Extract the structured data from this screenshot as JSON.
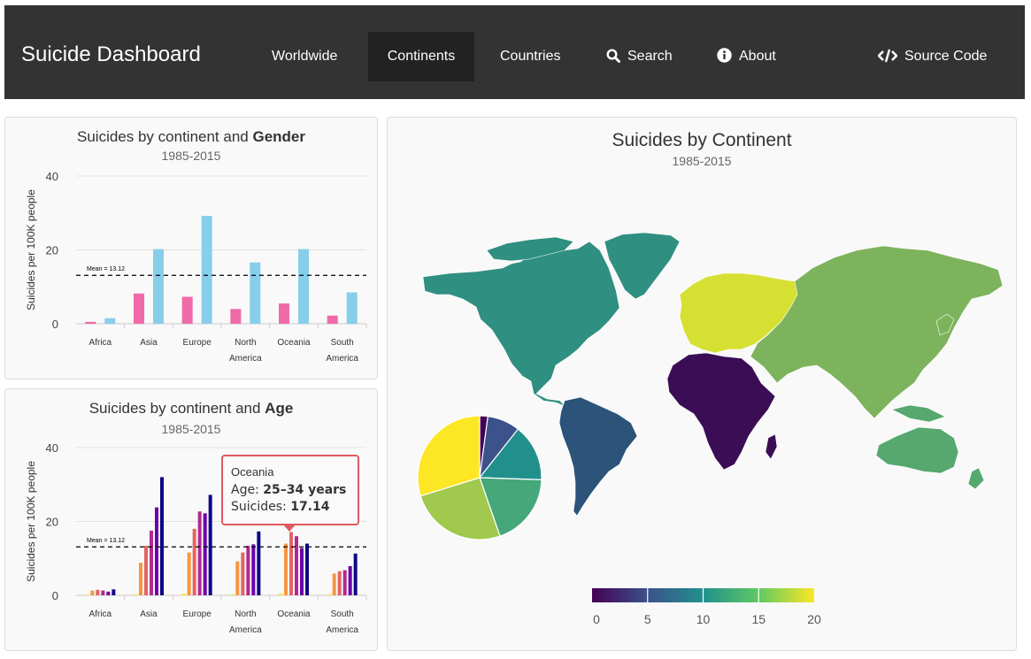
{
  "navbar": {
    "brand": "Suicide Dashboard",
    "items": [
      {
        "label": "Worldwide",
        "icon": ""
      },
      {
        "label": "Continents",
        "icon": "",
        "active": true
      },
      {
        "label": "Countries",
        "icon": ""
      },
      {
        "label": "Search",
        "icon": "search-icon"
      },
      {
        "label": "About",
        "icon": "info-icon"
      },
      {
        "label": "Source Code",
        "icon": "code-icon"
      }
    ]
  },
  "gender_panel": {
    "title_prefix": "Suicides by continent and ",
    "title_bold": "Gender",
    "subtitle": "1985-2015",
    "mean_label": "Mean = 13.12"
  },
  "age_panel": {
    "title_prefix": "Suicides by continent and ",
    "title_bold": "Age",
    "subtitle": "1985-2015",
    "mean_label": "Mean = 13.12"
  },
  "map_panel": {
    "title": "Suicides by Continent",
    "subtitle": "1985-2015",
    "colorbar_ticks": [
      "0",
      "5",
      "10",
      "15",
      "20"
    ]
  },
  "tooltip": {
    "continent": "Oceania",
    "age_label": "Age: ",
    "age_value": "25–34 years",
    "suicides_label": "Suicides: ",
    "suicides_value": "17.14"
  },
  "colors": {
    "female": "#f06aa8",
    "male": "#87ceeb",
    "age": [
      "#fde725",
      "#f89540",
      "#e16462",
      "#b12a90",
      "#6a00a8",
      "#0d0887"
    ],
    "tooltip_border": "#e0595f"
  },
  "chart_data": [
    {
      "type": "bar",
      "title": "Suicides by continent and Gender",
      "subtitle": "1985-2015",
      "ylabel": "Suicides per 100K people",
      "ylim": [
        0,
        40
      ],
      "yticks": [
        0,
        20,
        40
      ],
      "categories": [
        "Africa",
        "Asia",
        "Europe",
        "North America",
        "Oceania",
        "South America"
      ],
      "series": [
        {
          "name": "",
          "color": "#f06aa8",
          "values": [
            0.5,
            8.2,
            7.3,
            4.0,
            5.5,
            2.2
          ]
        },
        {
          "name": "",
          "color": "#87ceeb",
          "values": [
            1.5,
            20.2,
            29.2,
            16.6,
            20.2,
            8.5
          ]
        }
      ],
      "mean": 13.12,
      "grid": true
    },
    {
      "type": "bar",
      "title": "Suicides by continent and Age",
      "subtitle": "1985-2015",
      "ylabel": "Suicides per 100K people",
      "ylim": [
        0,
        40
      ],
      "yticks": [
        0,
        20,
        40
      ],
      "categories": [
        "Africa",
        "Asia",
        "Europe",
        "North America",
        "Oceania",
        "South America"
      ],
      "series": [
        {
          "name": "",
          "values": [
            0.2,
            0.3,
            0.5,
            0.3,
            0.5,
            0.3
          ]
        },
        {
          "name": "",
          "values": [
            1.3,
            8.8,
            11.6,
            9.2,
            14.0,
            5.9
          ]
        },
        {
          "name": "",
          "values": [
            1.5,
            13.4,
            18.0,
            11.6,
            17.14,
            6.5
          ]
        },
        {
          "name": "",
          "values": [
            1.3,
            17.5,
            22.7,
            13.4,
            16.0,
            6.8
          ]
        },
        {
          "name": "",
          "values": [
            1.0,
            23.8,
            22.2,
            13.8,
            12.8,
            7.9
          ]
        },
        {
          "name": "",
          "values": [
            1.6,
            32.0,
            27.2,
            17.3,
            14.0,
            11.3
          ]
        }
      ],
      "mean": 13.12,
      "grid": true
    },
    {
      "type": "pie",
      "values": [
        1.0,
        4.0,
        7.0,
        9.0,
        12.0,
        14.0
      ],
      "colors": [
        "#440154",
        "#3b528b",
        "#21908d",
        "#45a77a",
        "#a0c94d",
        "#fde725"
      ]
    }
  ]
}
